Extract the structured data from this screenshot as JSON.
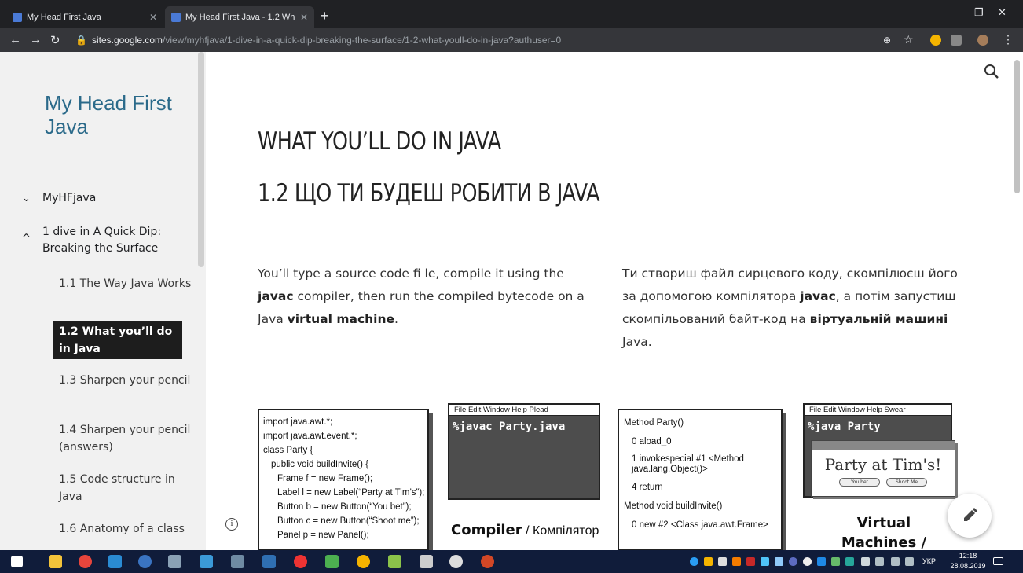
{
  "browser": {
    "tabs": [
      {
        "title": "My Head First Java"
      },
      {
        "title": "My Head First Java - 1.2 What yo"
      }
    ],
    "new_tab_symbol": "+",
    "url_host": "sites.google.com",
    "url_path": "/view/myhfjava/1-dive-in-a-quick-dip-breaking-the-surface/1-2-what-youll-do-in-java?authuser=0"
  },
  "sidebar": {
    "site_title": "My Head First Java",
    "top_items": [
      {
        "label": "MyHFjava",
        "chevron": "⌄"
      },
      {
        "label": "1 dive in A Quick Dip: Breaking the Surface",
        "chevron": "^"
      }
    ],
    "items": [
      {
        "label": "1.1 The Way Java Works"
      },
      {
        "label": "1.2 What you’ll do in Java"
      },
      {
        "label": "1.3 Sharpen your pencil"
      },
      {
        "label": "1.4 Sharpen your pencil (answers)"
      },
      {
        "label": "1.5 Code structure in Java"
      },
      {
        "label": "1.6 Anatomy of a class"
      }
    ]
  },
  "main": {
    "heading_en": "WHAT YOU’LL DO IN JAVA",
    "heading_uk": "1.2 ЩО ТИ БУДЕШ РОБИТИ В JAVA",
    "para_en": {
      "p1": "You’ll type a source code ﬁ le, compile it using the ",
      "b1": "javac",
      "p2": " compiler, then run the compiled bytecode on a Java ",
      "b2": "virtual machine",
      "p3": "."
    },
    "para_uk": {
      "p1": "Ти створиш файл сирцевого коду, скомпілюєш його за допомогою компілятора ",
      "b1": "javac",
      "p2": ", а потім запустиш скомпільований байт-код на ",
      "b2": "віртуальній машині",
      "p3": " Java."
    },
    "source_code": [
      "import java.awt.*;",
      "import java.awt.event.*;",
      "class Party {",
      "  public void buildInvite() {",
      "    Frame f = new Frame();",
      "    Label l = new Label(“Party at Tim’s”);",
      "    Button b = new Button(“You bet”);",
      "    Button c = new Button(“Shoot me”);",
      "    Panel p = new Panel();"
    ],
    "compiler_menu": "File  Edit  Window  Help  Plead",
    "compiler_cmd": "%javac Party.java",
    "compiler_caption_bold": "Compiler",
    "compiler_caption_rest": " / Компілятор",
    "bytecode": [
      "Method Party()",
      "  0 aload_0",
      "  1 invokespecial #1 <Method java.lang.Object()>",
      "  4 return",
      "Method void buildInvite()",
      "  0 new #2 <Class java.awt.Frame>"
    ],
    "vm_menu": "File  Edit  Window  Help  Swear",
    "vm_cmd": "%java Party",
    "party_text": "Party at Tim's!",
    "party_btn1": "You bet",
    "party_btn2": "Shoot Me",
    "vm_caption": "Virtual Machines /"
  },
  "taskbar": {
    "language": "УКР",
    "time": "12:18",
    "date": "28.08.2019"
  }
}
